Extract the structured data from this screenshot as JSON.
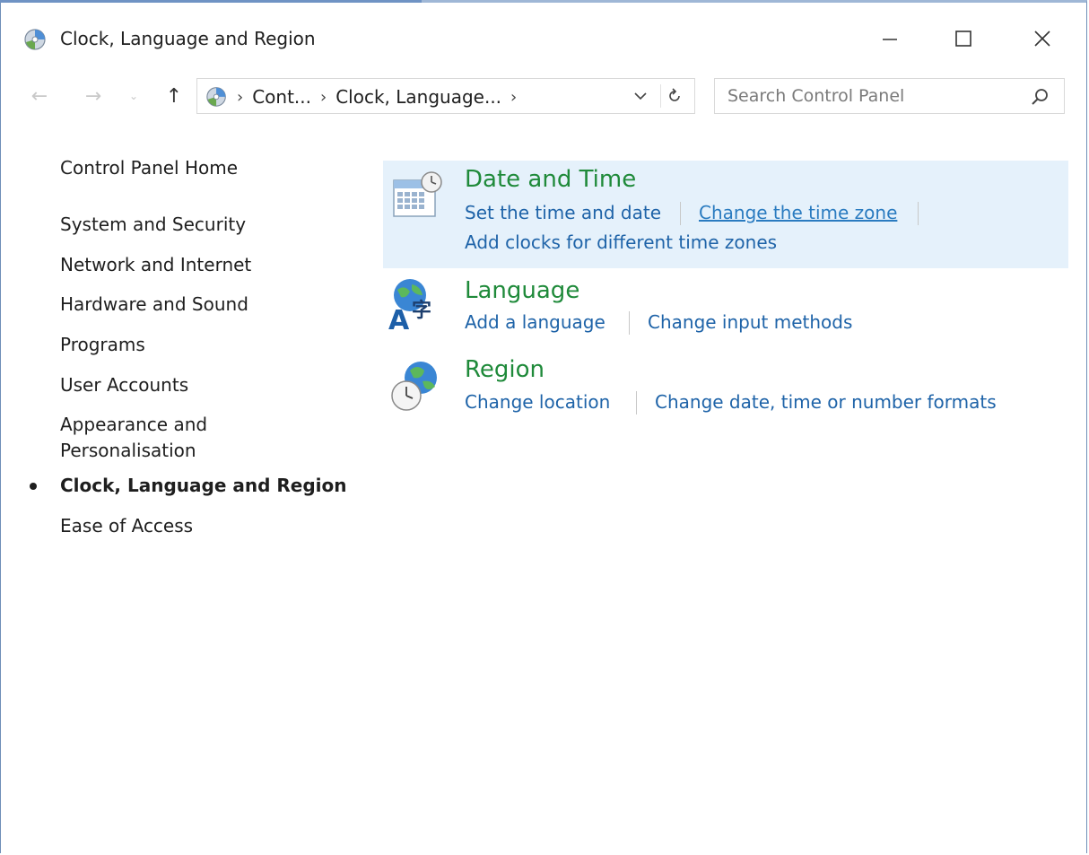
{
  "window": {
    "title": "Clock, Language and Region"
  },
  "address_bar": {
    "crumbs": [
      "Cont...",
      "Clock, Language..."
    ],
    "separator": "›"
  },
  "search": {
    "placeholder": "Search Control Panel"
  },
  "left_nav": {
    "home": "Control Panel Home",
    "items": [
      {
        "label": "System and Security"
      },
      {
        "label": "Network and Internet"
      },
      {
        "label": "Hardware and Sound"
      },
      {
        "label": "Programs"
      },
      {
        "label": "User Accounts"
      },
      {
        "label": "Appearance and",
        "label2": "Personalisation"
      },
      {
        "label": "Clock, Language and Region",
        "active": true
      },
      {
        "label": "Ease of Access"
      }
    ]
  },
  "categories": [
    {
      "title": "Date and Time",
      "icon": "calendar-clock-icon",
      "links": [
        "Set the time and date",
        "Change the time zone",
        "Add clocks for different time zones"
      ]
    },
    {
      "title": "Language",
      "icon": "language-globe-icon",
      "links": [
        "Add a language",
        "Change input methods"
      ]
    },
    {
      "title": "Region",
      "icon": "region-globe-clock-icon",
      "links": [
        "Change location",
        "Change date, time or number formats"
      ]
    }
  ],
  "colors": {
    "category_title": "#1f8a3a",
    "link": "#1e63a8",
    "highlight": "#e5f1fb"
  }
}
